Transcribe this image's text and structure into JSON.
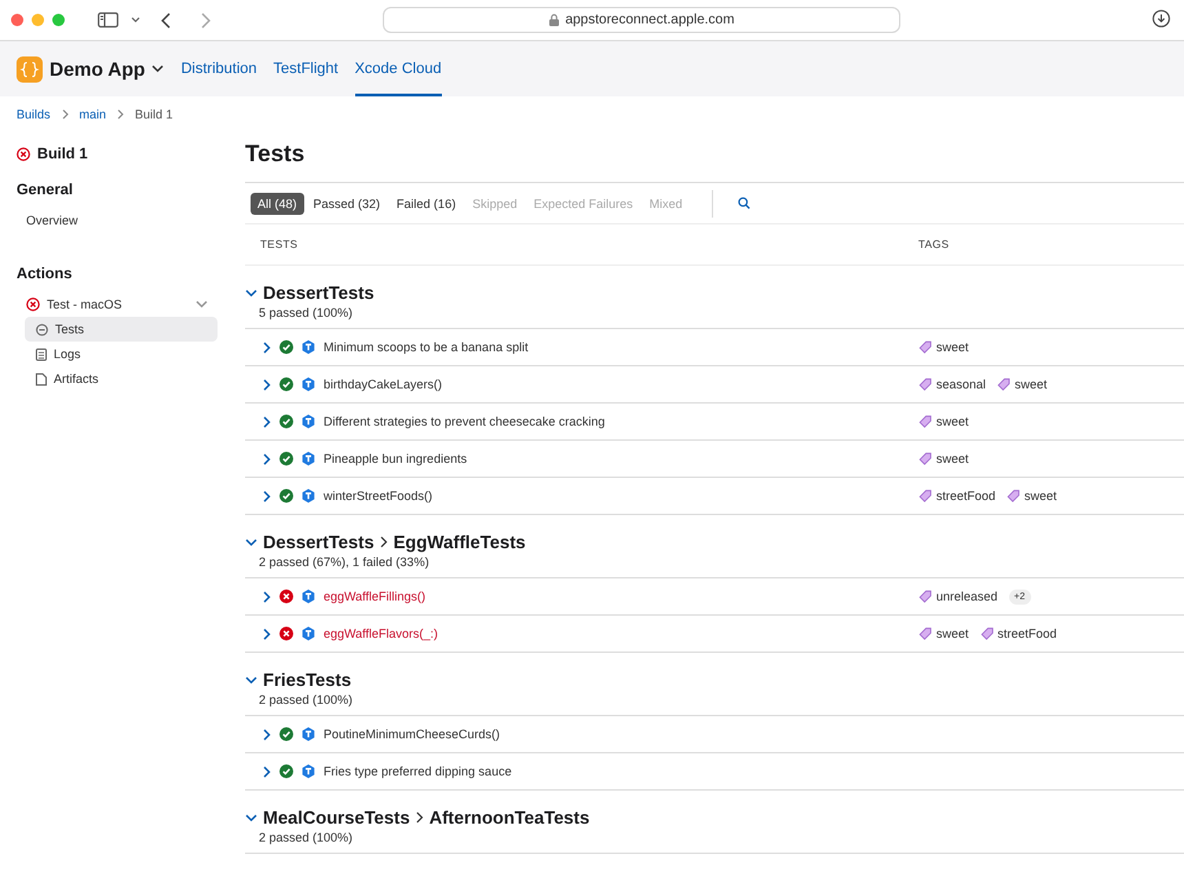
{
  "browser": {
    "url": "appstoreconnect.apple.com"
  },
  "app_nav": {
    "app_name": "Demo App",
    "tabs": [
      {
        "label": "Distribution",
        "selected": false
      },
      {
        "label": "TestFlight",
        "selected": false
      },
      {
        "label": "Xcode Cloud",
        "selected": true
      }
    ]
  },
  "breadcrumbs": [
    "Builds",
    "main",
    "Build 1"
  ],
  "sidebar": {
    "build": {
      "title": "Build 1",
      "kind": "failed"
    },
    "sections": [
      {
        "heading": "General",
        "items": [
          {
            "label": "Overview"
          }
        ]
      },
      {
        "heading": "Actions",
        "items": [
          {
            "label": "Test - macOS",
            "kind": "failed",
            "expanded": true,
            "children": [
              {
                "label": "Tests",
                "selected": true
              },
              {
                "label": "Logs",
                "selected": false
              },
              {
                "label": "Artifacts",
                "selected": false
              }
            ]
          }
        ]
      }
    ]
  },
  "page_title": "Tests",
  "filters": [
    {
      "label": "All (48)",
      "selected": true,
      "disabled": false
    },
    {
      "label": "Passed (32)",
      "selected": false,
      "disabled": false
    },
    {
      "label": "Failed (16)",
      "selected": false,
      "disabled": false
    },
    {
      "label": "Skipped",
      "selected": false,
      "disabled": true
    },
    {
      "label": "Expected Failures",
      "selected": false,
      "disabled": true
    },
    {
      "label": "Mixed",
      "selected": false,
      "disabled": true
    }
  ],
  "table": {
    "columns": [
      "TESTS",
      "TAGS"
    ],
    "groups": [
      {
        "path": [
          "DessertTests"
        ],
        "summary": "5 passed (100%)",
        "expanded": true,
        "rows": [
          {
            "name": "Minimum scoops to be a banana split",
            "kind": "passed",
            "expanded": false,
            "tags": [
              "sweet"
            ]
          },
          {
            "name": "birthdayCakeLayers()",
            "kind": "passed",
            "expanded": false,
            "tags": [
              "seasonal",
              "sweet"
            ]
          },
          {
            "name": "Different strategies to prevent cheesecake cracking",
            "kind": "passed",
            "expanded": false,
            "tags": [
              "sweet"
            ]
          },
          {
            "name": "Pineapple bun ingredients",
            "kind": "passed",
            "expanded": false,
            "tags": [
              "sweet"
            ]
          },
          {
            "name": "winterStreetFoods()",
            "kind": "passed",
            "expanded": false,
            "tags": [
              "streetFood",
              "sweet"
            ]
          }
        ]
      },
      {
        "path": [
          "DessertTests",
          "EggWaffleTests"
        ],
        "summary": "2 passed (67%), 1 failed (33%)",
        "expanded": true,
        "rows": [
          {
            "name": "eggWaffleFillings()",
            "kind": "failed",
            "expanded": false,
            "tags": [
              "unreleased"
            ],
            "more_tags": "+2"
          },
          {
            "name": "eggWaffleFlavors(_:)",
            "kind": "failed",
            "expanded": false,
            "tags": [
              "sweet",
              "streetFood"
            ]
          }
        ]
      },
      {
        "path": [
          "FriesTests"
        ],
        "summary": "2 passed (100%)",
        "expanded": true,
        "rows": [
          {
            "name": "PoutineMinimumCheeseCurds()",
            "kind": "passed",
            "expanded": false
          },
          {
            "name": "Fries type preferred dipping sauce",
            "kind": "passed",
            "expanded": false
          }
        ]
      },
      {
        "path": [
          "MealCourseTests",
          "AfternoonTeaTests"
        ],
        "summary": "2 passed (100%)",
        "expanded": true
      }
    ]
  }
}
